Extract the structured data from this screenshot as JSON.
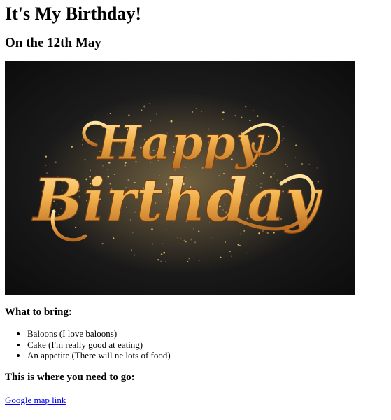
{
  "page": {
    "title": "It's My Birthday!",
    "date_heading": "On the 12th May"
  },
  "hero_image": {
    "text_line_1": "Happy",
    "text_line_2": "Birthday",
    "background_color": "#151515",
    "lettering_color": "#f2b552"
  },
  "bring": {
    "heading": "What to bring:",
    "items": [
      "Baloons (I love baloons)",
      "Cake (I'm really good at eating)",
      "An appetite (There will ne lots of food)"
    ]
  },
  "location": {
    "heading": "This is where you need to go:",
    "link_text": "Google map link"
  }
}
